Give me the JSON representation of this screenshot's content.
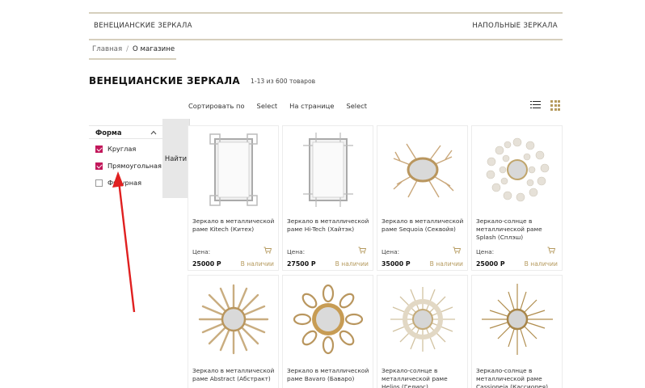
{
  "topmenu": {
    "left": "ВЕНЕЦИАНСКИЕ ЗЕРКАЛА",
    "right": "НАПОЛЬНЫЕ ЗЕРКАЛА"
  },
  "breadcrumb": {
    "home": "Главная",
    "sep": "/",
    "current": "О магазине"
  },
  "page": {
    "title": "ВЕНЕЦИАНСКИЕ ЗЕРКАЛА",
    "count": "1-13 из 600 товаров"
  },
  "sortbar": {
    "sort_label": "Сортировать по",
    "sort_value": "Select",
    "per_page_label": "На странице",
    "per_page_value": "Select"
  },
  "filter": {
    "title": "Форма",
    "options": [
      {
        "label": "Круглая",
        "checked": true
      },
      {
        "label": "Прямоугольная",
        "checked": true
      },
      {
        "label": "Фигурная",
        "checked": false
      }
    ],
    "button": "Найти"
  },
  "products": [
    {
      "name": "Зеркало в металлической раме Kitech (Китех)",
      "price_label": "Цена:",
      "price": "25000 Р",
      "stock": "В наличии",
      "image": "rect-frame-mirror"
    },
    {
      "name": "Зеркало в металлической раме Hi-Tech (Хайтэк)",
      "price_label": "Цена:",
      "price": "27500 Р",
      "stock": "В наличии",
      "image": "rect-frame-mirror"
    },
    {
      "name": "Зеркало в металлической раме Sequoia (Секвойя)",
      "price_label": "Цена:",
      "price": "35000 Р",
      "stock": "В наличии",
      "image": "branch-mirror"
    },
    {
      "name": "Зеркало-солнце в металлической раме Splash (Сплэш)",
      "price_label": "Цена:",
      "price": "25000 Р",
      "stock": "В наличии",
      "image": "splash-mirror"
    },
    {
      "name": "Зеркало в металлической раме Abstract (Абстракт)",
      "image": "sun-mirror"
    },
    {
      "name": "Зеркало в металлической раме Bavaro (Баваро)",
      "image": "flower-mirror"
    },
    {
      "name": "Зеркало-солнце в металлической раме Helios (Гелиос)",
      "image": "sun-mirror"
    },
    {
      "name": "Зеркало-солнце в металлической раме Cassiopeia (Кассиопея)",
      "image": "starburst-mirror"
    }
  ],
  "colors": {
    "accent": "#b59a5e",
    "checkbox": "#c2185b",
    "arrow": "#e02020",
    "divider": "#d6cfbd"
  }
}
